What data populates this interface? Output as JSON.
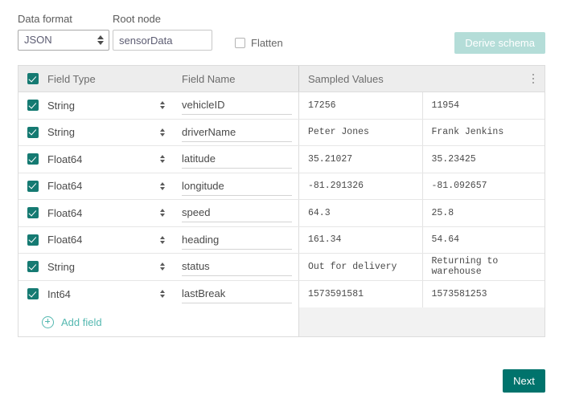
{
  "toolbar": {
    "data_format_label": "Data format",
    "data_format_value": "JSON",
    "data_format_options": [
      "JSON"
    ],
    "root_node_label": "Root node",
    "root_node_value": "sensorData",
    "flatten_label": "Flatten",
    "flatten_checked": false,
    "derive_schema_label": "Derive schema",
    "derive_schema_disabled": true
  },
  "table": {
    "headers": {
      "field_type": "Field Type",
      "field_name": "Field Name",
      "sampled_values": "Sampled Values"
    },
    "header_checkbox_checked": true,
    "rows": [
      {
        "checked": true,
        "type": "String",
        "name": "vehicleID",
        "sample1": "17256",
        "sample2": "11954"
      },
      {
        "checked": true,
        "type": "String",
        "name": "driverName",
        "sample1": "Peter Jones",
        "sample2": "Frank Jenkins"
      },
      {
        "checked": true,
        "type": "Float64",
        "name": "latitude",
        "sample1": "35.21027",
        "sample2": "35.23425"
      },
      {
        "checked": true,
        "type": "Float64",
        "name": "longitude",
        "sample1": "-81.291326",
        "sample2": "-81.092657"
      },
      {
        "checked": true,
        "type": "Float64",
        "name": "speed",
        "sample1": "64.3",
        "sample2": "25.8"
      },
      {
        "checked": true,
        "type": "Float64",
        "name": "heading",
        "sample1": "161.34",
        "sample2": "54.64"
      },
      {
        "checked": true,
        "type": "String",
        "name": "status",
        "sample1": "Out for delivery",
        "sample2": "Returning to warehouse"
      },
      {
        "checked": true,
        "type": "Int64",
        "name": "lastBreak",
        "sample1": "1573591581",
        "sample2": "1573581253"
      }
    ],
    "add_field_label": "Add field",
    "type_options": [
      "String",
      "Float64",
      "Int64"
    ]
  },
  "footer": {
    "next_label": "Next"
  },
  "colors": {
    "accent_teal": "#00736c",
    "checkbox_teal": "#157a72",
    "add_field_teal": "#54b8b0",
    "derive_disabled": "#b4ddd8",
    "header_bg": "#ededed",
    "border": "#dcdcdc"
  }
}
